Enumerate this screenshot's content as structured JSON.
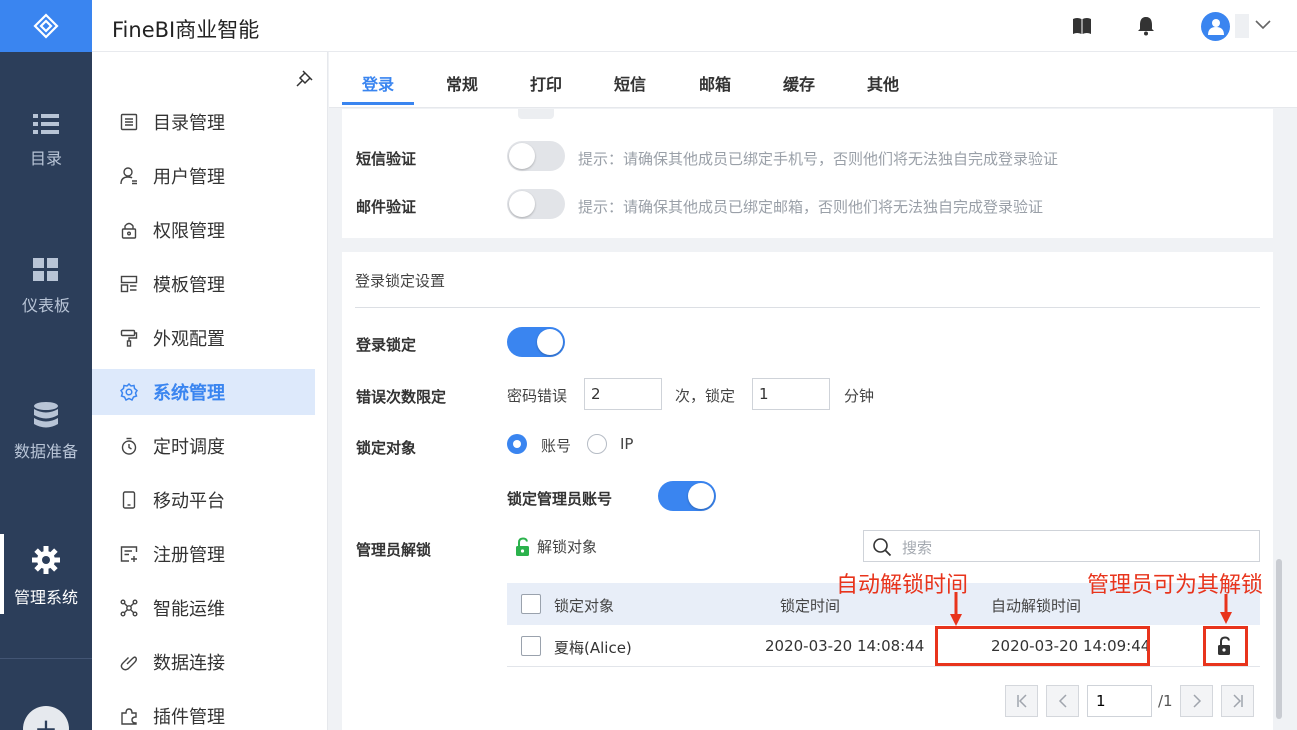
{
  "app": {
    "title": "FineBI商业智能"
  },
  "rail": {
    "items": [
      {
        "label": "目录",
        "icon": "list-icon"
      },
      {
        "label": "仪表板",
        "icon": "dashboard-icon"
      },
      {
        "label": "数据准备",
        "icon": "database-icon"
      },
      {
        "label": "管理系统",
        "icon": "gear-icon",
        "active": true
      }
    ],
    "add_label": "+"
  },
  "submenu": {
    "items": [
      {
        "label": "目录管理",
        "icon": "catalog-icon"
      },
      {
        "label": "用户管理",
        "icon": "user-icon"
      },
      {
        "label": "权限管理",
        "icon": "lock-icon"
      },
      {
        "label": "模板管理",
        "icon": "template-icon"
      },
      {
        "label": "外观配置",
        "icon": "brush-icon"
      },
      {
        "label": "系统管理",
        "icon": "gear-icon",
        "active": true
      },
      {
        "label": "定时调度",
        "icon": "timer-icon"
      },
      {
        "label": "移动平台",
        "icon": "mobile-icon"
      },
      {
        "label": "注册管理",
        "icon": "register-icon"
      },
      {
        "label": "智能运维",
        "icon": "ops-icon"
      },
      {
        "label": "数据连接",
        "icon": "link-icon"
      },
      {
        "label": "插件管理",
        "icon": "plugin-icon"
      }
    ]
  },
  "tabs": [
    "登录",
    "常规",
    "打印",
    "短信",
    "邮箱",
    "缓存",
    "其他"
  ],
  "verification": {
    "sms": {
      "label": "短信验证",
      "enabled": false,
      "hint": "提示：请确保其他成员已绑定手机号，否则他们将无法独自完成登录验证"
    },
    "email": {
      "label": "邮件验证",
      "enabled": false,
      "hint": "提示：请确保其他成员已绑定邮箱，否则他们将无法独自完成登录验证"
    }
  },
  "lock": {
    "section_title": "登录锁定设置",
    "login_lock": {
      "label": "登录锁定",
      "enabled": true
    },
    "error_limit": {
      "label": "错误次数限定",
      "prefix": "密码错误",
      "count": "2",
      "middle": "次，锁定",
      "minutes": "1",
      "suffix": "分钟"
    },
    "target": {
      "label": "锁定对象",
      "options": [
        "账号",
        "IP"
      ],
      "selected": "账号"
    },
    "admin_account": {
      "label": "锁定管理员账号",
      "enabled": true
    },
    "admin_unlock": {
      "label": "管理员解锁",
      "unlock_button": "解锁对象",
      "search_placeholder": "搜索",
      "columns": [
        "锁定对象",
        "锁定时间",
        "自动解锁时间"
      ],
      "rows": [
        {
          "object": "夏梅(Alice)",
          "lock_time": "2020-03-20 14:08:44",
          "unlock_time": "2020-03-20 14:09:44"
        }
      ]
    },
    "pager": {
      "page": "1",
      "total": "/1"
    }
  },
  "annotations": {
    "auto_unlock": "自动解锁时间",
    "admin_can_unlock": "管理员可为其解锁",
    "color": "#e8341c"
  },
  "colors": {
    "accent": "#3a85f0",
    "rail": "#2c3e5a"
  }
}
